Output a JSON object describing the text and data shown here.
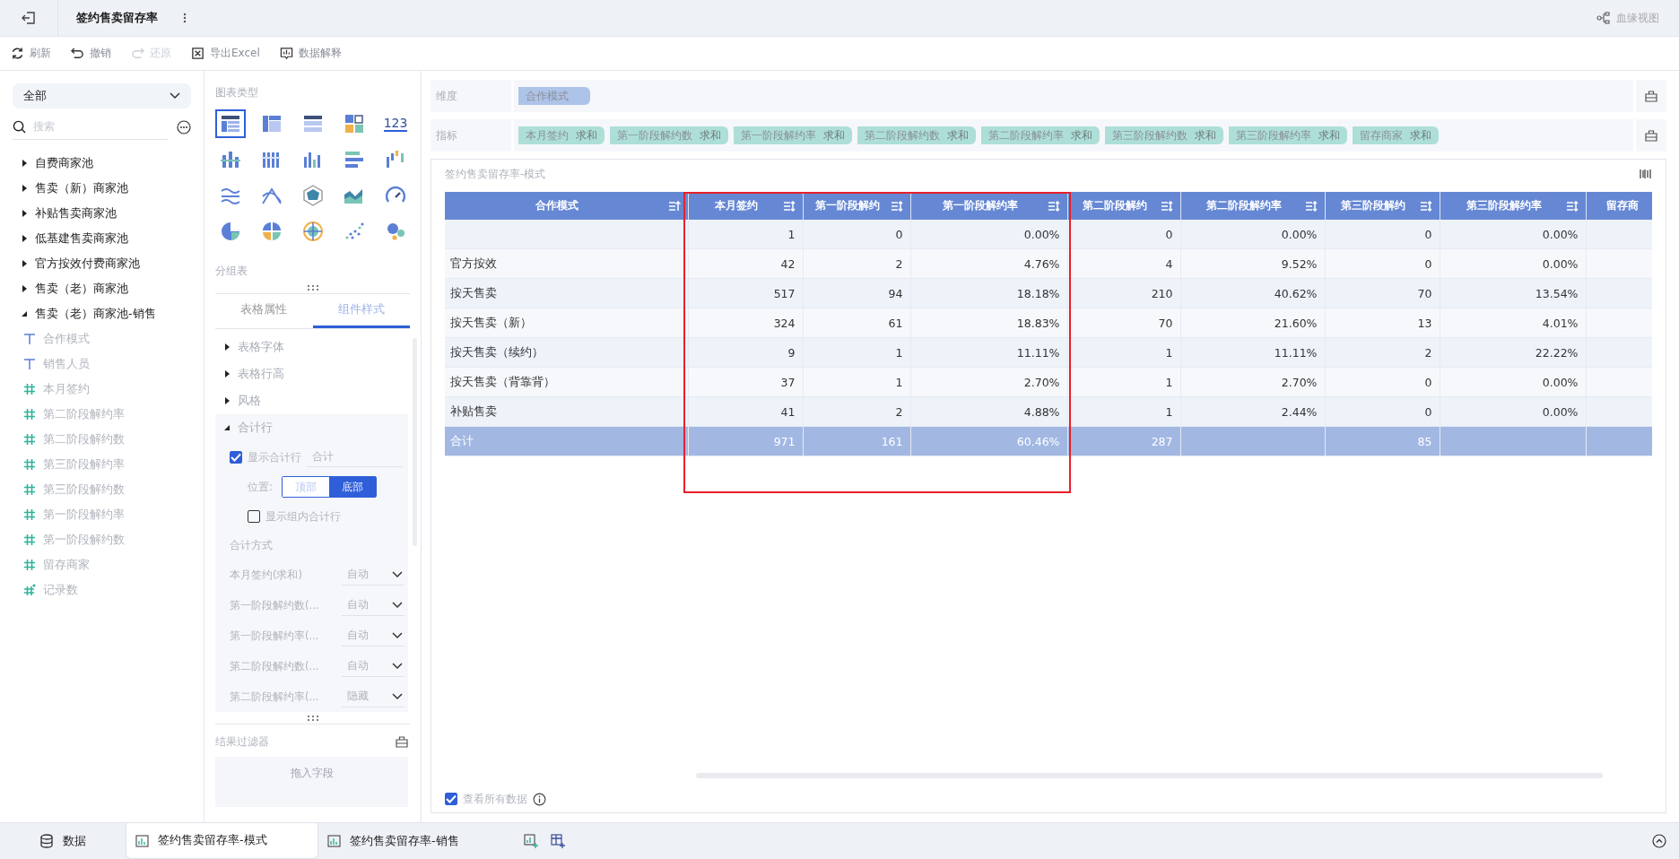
{
  "app_bar": {
    "title": "签约售卖留存率",
    "lineage_label": "血缘视图"
  },
  "toolbar": [
    {
      "kind": "refresh",
      "label": "刷新",
      "disabled": false
    },
    {
      "kind": "undo",
      "label": "撤销",
      "disabled": false
    },
    {
      "kind": "redo",
      "label": "还原",
      "disabled": true
    },
    {
      "kind": "excel",
      "label": "导出Excel",
      "disabled": false
    },
    {
      "kind": "explain",
      "label": "数据解释",
      "disabled": false
    }
  ],
  "sidebar": {
    "scope": "全部",
    "search": {
      "placeholder": "搜索"
    },
    "tree": [
      {
        "label": "自费商家池",
        "expanded": false
      },
      {
        "label": "售卖（新）商家池",
        "expanded": false
      },
      {
        "label": "补贴售卖商家池",
        "expanded": false
      },
      {
        "label": "低基建售卖商家池",
        "expanded": false
      },
      {
        "label": "官方按效付费商家池",
        "expanded": false
      },
      {
        "label": "售卖（老）商家池",
        "expanded": false
      },
      {
        "label": "售卖（老）商家池-销售",
        "expanded": true,
        "children": [
          {
            "kind": "text",
            "label": "合作模式"
          },
          {
            "kind": "text",
            "label": "销售人员"
          },
          {
            "kind": "number",
            "label": "本月签约"
          },
          {
            "kind": "number",
            "label": "第二阶段解约率"
          },
          {
            "kind": "number",
            "label": "第二阶段解约数"
          },
          {
            "kind": "number",
            "label": "第三阶段解约率"
          },
          {
            "kind": "number",
            "label": "第三阶段解约数"
          },
          {
            "kind": "number",
            "label": "第一阶段解约率"
          },
          {
            "kind": "number",
            "label": "第一阶段解约数"
          },
          {
            "kind": "number",
            "label": "留存商家"
          },
          {
            "kind": "count",
            "label": "记录数"
          }
        ]
      }
    ]
  },
  "chart_types": {
    "title": "图表类型",
    "items": [
      {
        "kind": "table",
        "selected": true
      },
      {
        "kind": "cross-table",
        "selected": false
      },
      {
        "kind": "detail-table",
        "selected": false
      },
      {
        "kind": "blocks",
        "selected": false
      },
      {
        "kind": "number",
        "label": "123",
        "selected": false
      },
      {
        "kind": "stacked-bar",
        "selected": false
      },
      {
        "kind": "grouped-bar",
        "selected": false
      },
      {
        "kind": "bar",
        "selected": false
      },
      {
        "kind": "horizontal-bar",
        "selected": false
      },
      {
        "kind": "waterfall",
        "selected": false
      },
      {
        "kind": "wave",
        "selected": false
      },
      {
        "kind": "cross-line",
        "selected": false
      },
      {
        "kind": "radar",
        "selected": false
      },
      {
        "kind": "area",
        "selected": false
      },
      {
        "kind": "gauge",
        "selected": false
      },
      {
        "kind": "pie",
        "selected": false
      },
      {
        "kind": "split-pie",
        "selected": false
      },
      {
        "kind": "sunburst",
        "selected": false
      },
      {
        "kind": "scatter",
        "selected": false
      },
      {
        "kind": "bubble",
        "selected": false
      }
    ],
    "group_table_label": "分组表"
  },
  "panel_tabs": [
    {
      "label": "表格属性",
      "selected": false
    },
    {
      "label": "组件样式",
      "selected": true
    }
  ],
  "style_sections": [
    {
      "label": "表格字体",
      "expanded": false
    },
    {
      "label": "表格行高",
      "expanded": false
    },
    {
      "label": "风格",
      "expanded": false
    },
    {
      "label": "合计行",
      "expanded": true
    }
  ],
  "total_row": {
    "show": {
      "label": "显示合计行",
      "checked": true,
      "value": "合计"
    },
    "position": {
      "label": "位置:",
      "options": [
        {
          "label": "顶部",
          "selected": false
        },
        {
          "label": "底部",
          "selected": true
        }
      ]
    },
    "group_total": {
      "label": "显示组内合计行",
      "checked": false
    },
    "method_label": "合计方式",
    "methods": [
      {
        "label": "本月签约(求和)",
        "value": "自动"
      },
      {
        "label": "第一阶段解约数(...",
        "value": "自动"
      },
      {
        "label": "第一阶段解约率(...",
        "value": "自动"
      },
      {
        "label": "第二阶段解约数(...",
        "value": "自动"
      },
      {
        "label": "第二阶段解约率(...",
        "value": "隐藏"
      }
    ]
  },
  "result_filter": {
    "title": "结果过滤器",
    "placeholder": "拖入字段"
  },
  "dimensions": {
    "label": "维度",
    "fields": [
      {
        "label": "合作模式"
      }
    ]
  },
  "metrics": {
    "label": "指标",
    "fields": [
      {
        "label": "本月签约",
        "agg": "求和"
      },
      {
        "label": "第一阶段解约数",
        "agg": "求和"
      },
      {
        "label": "第一阶段解约率",
        "agg": "求和"
      },
      {
        "label": "第二阶段解约数",
        "agg": "求和"
      },
      {
        "label": "第二阶段解约率",
        "agg": "求和"
      },
      {
        "label": "第三阶段解约数",
        "agg": "求和"
      },
      {
        "label": "第三阶段解约率",
        "agg": "求和"
      },
      {
        "label": "留存商家",
        "agg": "求和"
      }
    ]
  },
  "chart": {
    "title": "签约售卖留存率-模式",
    "columns": [
      {
        "label": "合作模式",
        "kind": "sorted"
      },
      {
        "label": "本月签约",
        "kind": "sortable"
      },
      {
        "label": "第一阶段解约",
        "kind": "sortable"
      },
      {
        "label": "第一阶段解约率",
        "kind": "sortable"
      },
      {
        "label": "第二阶段解约",
        "kind": "sortable"
      },
      {
        "label": "第二阶段解约率",
        "kind": "sortable"
      },
      {
        "label": "第三阶段解约",
        "kind": "sortable"
      },
      {
        "label": "第三阶段解约率",
        "kind": "sortable"
      },
      {
        "label": "留存商"
      }
    ],
    "rows": [
      {
        "col_2": "1",
        "col_3": "0",
        "col_4": "0.00%",
        "col_5": "0",
        "col_6": "0.00%",
        "col_7": "0",
        "col_8": "0.00%"
      },
      {
        "col_1": "官方按效",
        "col_2": "42",
        "col_3": "2",
        "col_4": "4.76%",
        "col_5": "4",
        "col_6": "9.52%",
        "col_7": "0",
        "col_8": "0.00%"
      },
      {
        "col_1": "按天售卖",
        "col_2": "517",
        "col_3": "94",
        "col_4": "18.18%",
        "col_5": "210",
        "col_6": "40.62%",
        "col_7": "70",
        "col_8": "13.54%"
      },
      {
        "col_1": "按天售卖（新）",
        "col_2": "324",
        "col_3": "61",
        "col_4": "18.83%",
        "col_5": "70",
        "col_6": "21.60%",
        "col_7": "13",
        "col_8": "4.01%"
      },
      {
        "col_1": "按天售卖（续约）",
        "col_2": "9",
        "col_3": "1",
        "col_4": "11.11%",
        "col_5": "1",
        "col_6": "11.11%",
        "col_7": "2",
        "col_8": "22.22%"
      },
      {
        "col_1": "按天售卖（背靠背）",
        "col_2": "37",
        "col_3": "1",
        "col_4": "2.70%",
        "col_5": "1",
        "col_6": "2.70%",
        "col_7": "0",
        "col_8": "0.00%"
      },
      {
        "col_1": "补贴售卖",
        "col_2": "41",
        "col_3": "2",
        "col_4": "4.88%",
        "col_5": "1",
        "col_6": "2.44%",
        "col_7": "0",
        "col_8": "0.00%"
      }
    ],
    "total": {
      "col_1": "合计",
      "col_2": "971",
      "col_3": "161",
      "col_4": "60.46%",
      "col_5": "287",
      "col_7": "85"
    },
    "view_all": {
      "label": "查看所有数据",
      "checked": true
    }
  },
  "bottom_tabs": [
    {
      "kind": "data",
      "label": "数据",
      "selected": false
    },
    {
      "kind": "sheet",
      "label": "签约售卖留存率-模式",
      "selected": true
    },
    {
      "kind": "sheet",
      "label": "签约售卖留存率-销售",
      "selected": false
    }
  ]
}
